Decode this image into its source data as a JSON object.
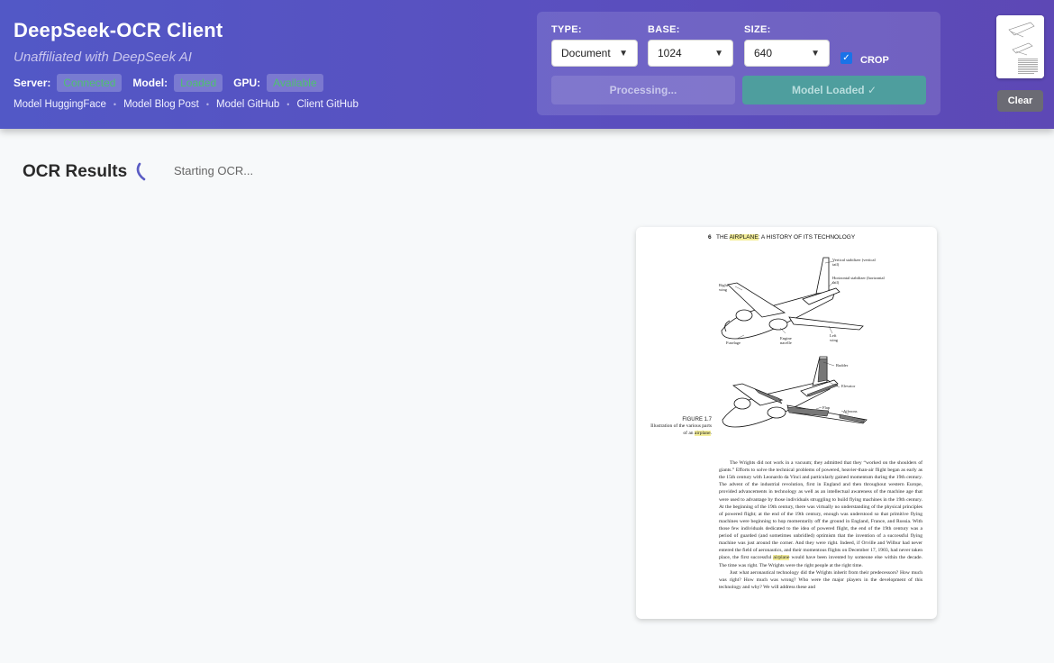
{
  "app": {
    "title": "DeepSeek-OCR Client",
    "subtitle": "Unaffiliated with DeepSeek AI"
  },
  "status": {
    "server_label": "Server:",
    "server_value": "Connected",
    "model_label": "Model:",
    "model_value": "Loaded",
    "gpu_label": "GPU:",
    "gpu_value": "Available",
    "badge_color": "#4fc16f"
  },
  "links": [
    "Model HuggingFace",
    "Model Blog Post",
    "Model GitHub",
    "Client GitHub"
  ],
  "controls": {
    "type_label": "TYPE:",
    "type_value": "Document",
    "base_label": "BASE:",
    "base_value": "1024",
    "size_label": "SIZE:",
    "size_value": "640",
    "crop_label": "CROP",
    "crop_checked": true,
    "processing_button": "Processing...",
    "model_loaded_button": "Model Loaded ✓"
  },
  "clear_button": "Clear",
  "results": {
    "title": "OCR Results",
    "status": "Starting OCR..."
  },
  "document": {
    "header_page": "6",
    "header_pre": "THE ",
    "header_highlight": "AIRPLANE",
    "header_post": ": A HISTORY OF ITS TECHNOLOGY",
    "figure_number": "FIGURE 1.7",
    "figure_caption_pre": "Illustration of the various parts of an ",
    "figure_caption_highlight": "airplane",
    "figure_caption_post": ".",
    "labels_top": {
      "vertical_stabilizer": "Vertical stabilizer (vertical tail)",
      "horizontal_stabilizer": "Horizontal stabilizer (horizontal tail)",
      "right_wing": "Right wing",
      "fuselage": "Fuselage",
      "engine_nacelle": "Engine nacelle",
      "left_wing": "Left wing"
    },
    "labels_bottom": {
      "rudder": "Rudder",
      "elevator": "Elevator",
      "flap": "Flap",
      "ailerons": "Ailerons"
    },
    "body_pre": "The Wrights did not work in a vacuum; they admitted that they “worked on the shoulders of giants.” Efforts to solve the technical problems of powered, heavier-than-air flight began as early as the 15th century with Leonardo da Vinci and particularly gained momentum during the 19th century. The advent of the industrial revolution, first in England and then throughout western Europe, provided advancements in technology as well as an intellectual awareness of the machine age that were used to advantage by those individuals struggling to build flying machines in the 19th century. At the beginning of the 19th century, there was virtually no understanding of the physical principles of powered flight; at the end of the 19th century, enough was understood so that primitive flying machines were beginning to hop momentarily off the ground in England, France, and Russia. With those few individuals dedicated to the idea of powered flight, the end of the 19th century was a period of guarded (and sometimes unbridled) optimism that the invention of a successful flying machine was just around the corner. And they were right. Indeed, if Orville and Wilbur had never entered the field of aeronautics, and their momentous flights on December 17, 1903, had never taken place, the first successful ",
    "body_highlight": "airplane",
    "body_post": " would have been invented by someone else within the decade. The time was right. The Wrights were the right people at the right time.",
    "body_para2": "Just what aeronautical technology did the Wrights inherit from their predecessors? How much was right? How much was wrong? Who were the major players in the development of this technology and why? We will address these and"
  }
}
